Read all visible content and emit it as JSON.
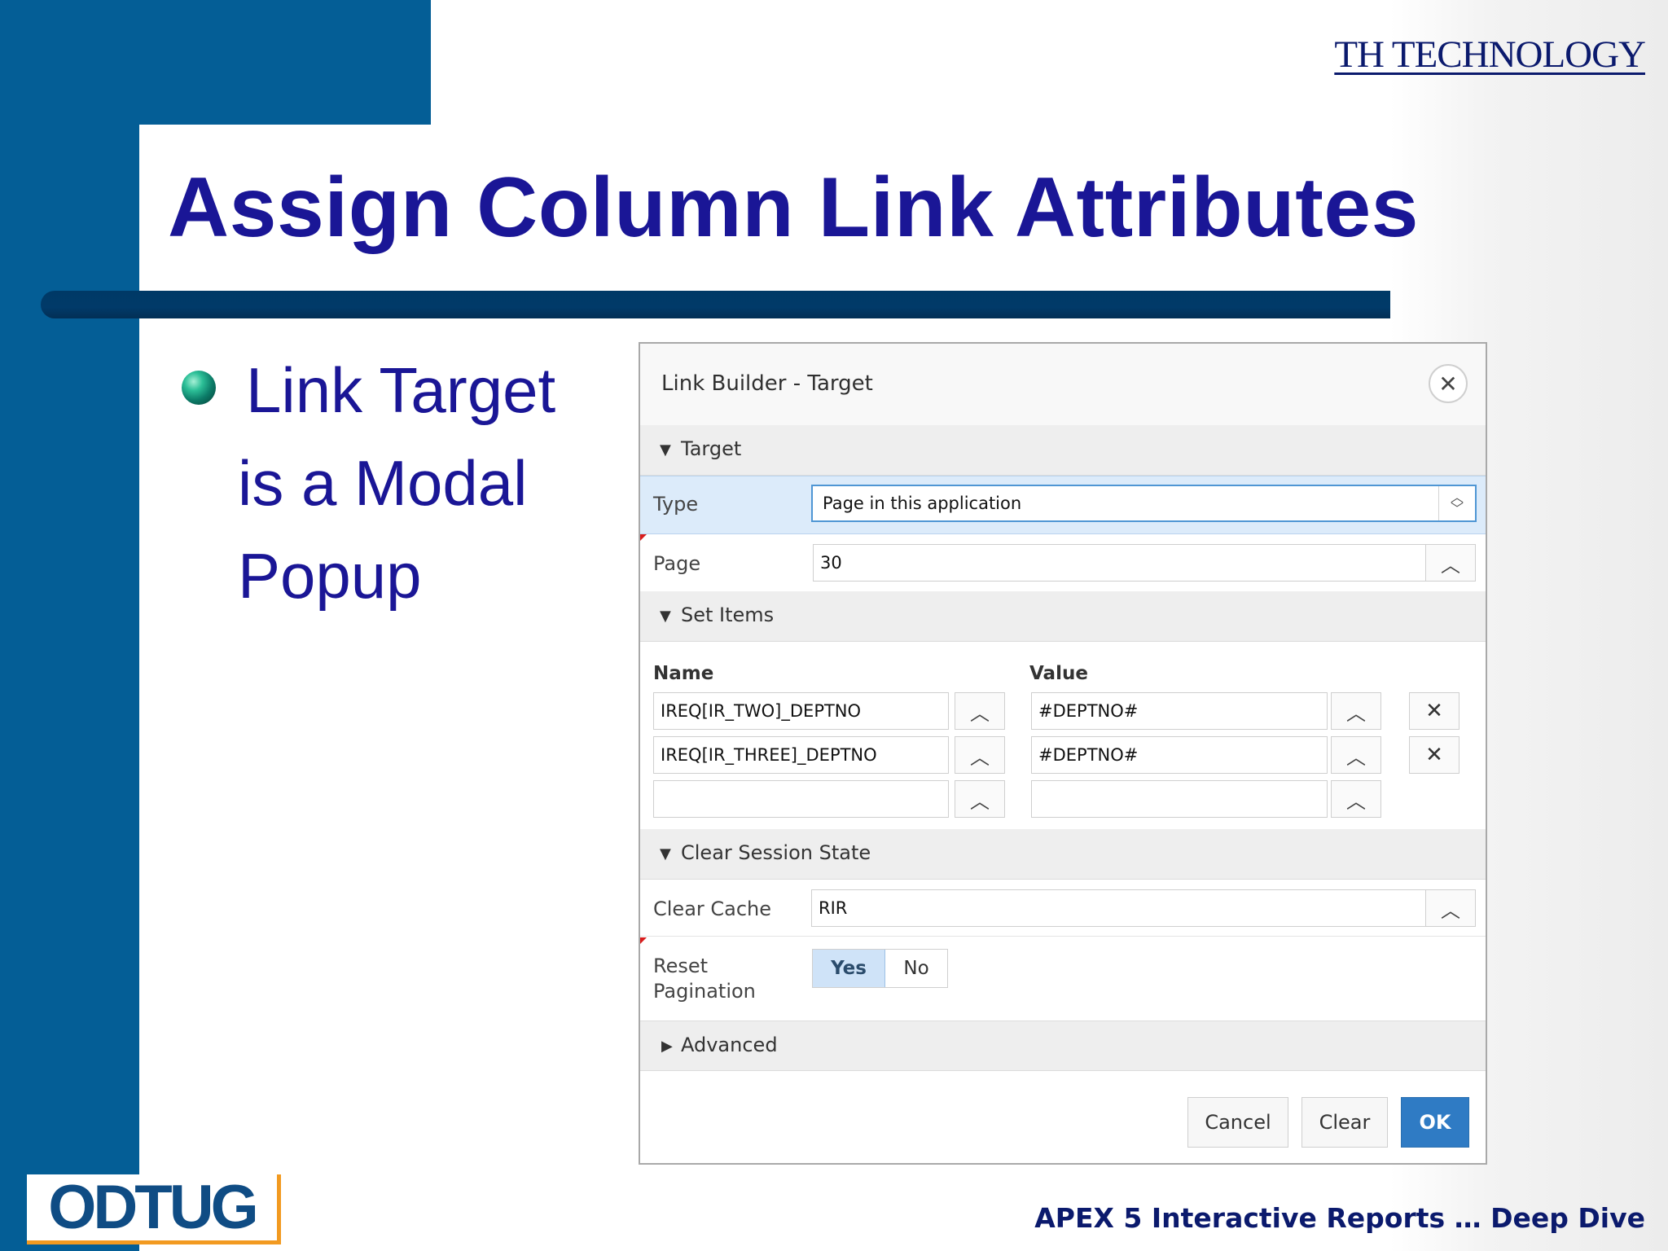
{
  "slide": {
    "corner_logo": "TH TECHNOLOGY",
    "title": "Assign Column Link Attributes",
    "bullet": {
      "line1": "Link Target",
      "line2": "is a Modal",
      "line3": "Popup"
    },
    "odtug_logo": "ODTUG",
    "footer": "APEX 5 Interactive Reports … Deep Dive",
    "colors": {
      "band": "#045e96",
      "title": "#1a1696",
      "rule": "#003966",
      "logo_accent": "#f29a21"
    }
  },
  "dialog": {
    "title": "Link Builder - Target",
    "close_icon": "close-icon",
    "sections": {
      "target": "Target",
      "set_items": "Set Items",
      "clear_session_state": "Clear Session State",
      "advanced": "Advanced"
    },
    "type": {
      "label": "Type",
      "value": "Page in this application"
    },
    "page": {
      "label": "Page",
      "value": "30"
    },
    "set_items": {
      "name_header": "Name",
      "value_header": "Value",
      "rows": [
        {
          "name": "IREQ[IR_TWO]_DEPTNO",
          "value": "#DEPTNO#"
        },
        {
          "name": "IREQ[IR_THREE]_DEPTNO",
          "value": "#DEPTNO#"
        },
        {
          "name": "",
          "value": ""
        }
      ]
    },
    "clear_cache": {
      "label": "Clear Cache",
      "value": "RIR"
    },
    "reset_pagination": {
      "label_line1": "Reset",
      "label_line2": "Pagination",
      "yes": "Yes",
      "no": "No",
      "selected": "Yes"
    },
    "buttons": {
      "cancel": "Cancel",
      "clear": "Clear",
      "ok": "OK"
    },
    "colors": {
      "ok_button": "#2f7bc4",
      "select_border": "#4f96d4",
      "highlight_row": "#dcebfa"
    }
  }
}
